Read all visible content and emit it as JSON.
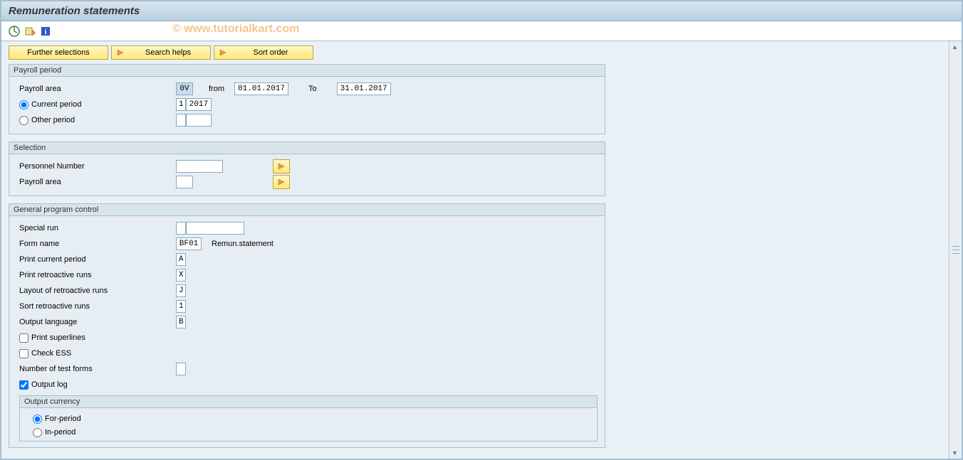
{
  "title": "Remuneration statements",
  "watermark": "© www.tutorialkart.com",
  "buttons": {
    "further_selections": "Further selections",
    "search_helps": "Search helps",
    "sort_order": "Sort order"
  },
  "payroll_period": {
    "title": "Payroll period",
    "payroll_area_label": "Payroll area",
    "payroll_area_value": "0V",
    "from_label": "from",
    "from_value": "01.01.2017",
    "to_label": "To",
    "to_value": "31.01.2017",
    "current_period_label": "Current period",
    "current_period_selected": true,
    "current_period_num": "1",
    "current_period_year": "2017",
    "other_period_label": "Other period",
    "other_period_selected": false
  },
  "selection": {
    "title": "Selection",
    "personnel_number_label": "Personnel Number",
    "personnel_number_value": "",
    "payroll_area_label": "Payroll area",
    "payroll_area_value": ""
  },
  "gpc": {
    "title": "General program control",
    "special_run_label": "Special run",
    "special_run_v1": "",
    "special_run_v2": "",
    "form_name_label": "Form name",
    "form_name_value": "BF01",
    "form_name_desc": "Remun.statement",
    "print_current_label": "Print current period",
    "print_current_value": "A",
    "print_retro_label": "Print retroactive runs",
    "print_retro_value": "X",
    "layout_retro_label": "Layout of retroactive runs",
    "layout_retro_value": "J",
    "sort_retro_label": "Sort retroactive runs",
    "sort_retro_value": "1",
    "output_lang_label": "Output language",
    "output_lang_value": "B",
    "print_superlines_label": "Print superlines",
    "print_superlines_checked": false,
    "check_ess_label": "Check ESS",
    "check_ess_checked": false,
    "num_test_label": "Number of test forms",
    "num_test_value": "",
    "output_log_label": "Output log",
    "output_log_checked": true,
    "output_currency": {
      "title": "Output currency",
      "for_period_label": "For-period",
      "for_period_selected": true,
      "in_period_label": "In-period",
      "in_period_selected": false
    }
  }
}
